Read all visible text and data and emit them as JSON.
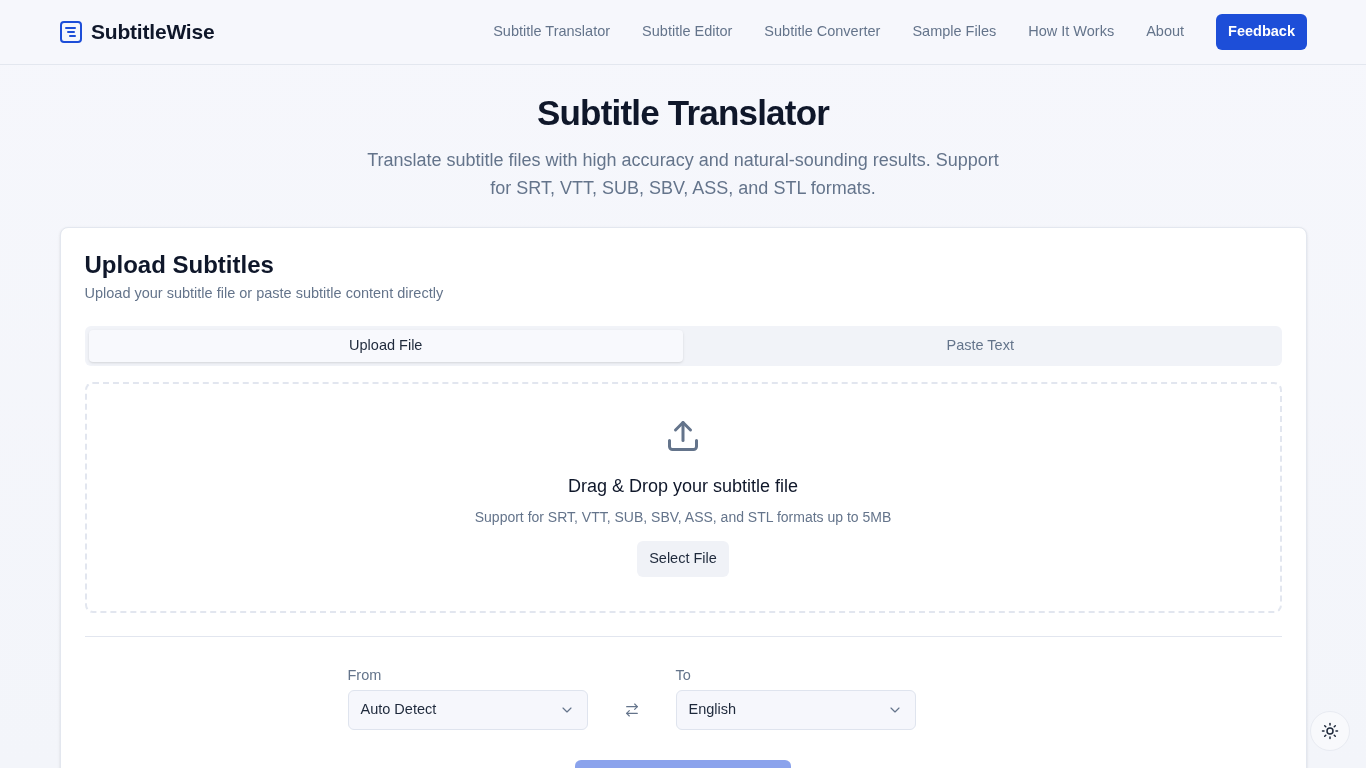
{
  "header": {
    "logo": "SubtitleWise",
    "nav": [
      "Subtitle Translator",
      "Subtitle Editor",
      "Subtitle Converter",
      "Sample Files",
      "How It Works",
      "About"
    ],
    "feedback_button": "Feedback"
  },
  "hero": {
    "title": "Subtitle Translator",
    "subtitle": "Translate subtitle files with high accuracy and natural-sounding results. Support for SRT, VTT, SUB, SBV, ASS, and STL formats."
  },
  "upload_card": {
    "title": "Upload Subtitles",
    "description": "Upload your subtitle file or paste subtitle content directly",
    "tabs": [
      {
        "label": "Upload File",
        "selected": true
      },
      {
        "label": "Paste Text",
        "selected": false
      }
    ],
    "dropzone": {
      "heading": "Drag & Drop your subtitle file",
      "hint": "Support for SRT, VTT, SUB, SBV, ASS, and STL formats up to 5MB",
      "button": "Select File"
    },
    "from": {
      "label": "From",
      "value": "Auto Detect"
    },
    "to": {
      "label": "To",
      "value": "English"
    }
  }
}
